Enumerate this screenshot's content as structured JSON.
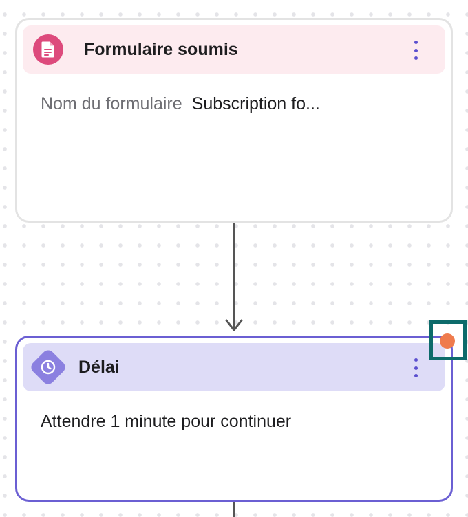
{
  "trigger_node": {
    "title": "Formulaire soumis",
    "icon": "form-document-icon",
    "field_label": "Nom du formulaire",
    "field_value": "Subscription fo..."
  },
  "delay_node": {
    "title": "Délai",
    "icon": "clock-icon",
    "description": "Attendre 1 minute pour continuer"
  },
  "colors": {
    "trigger_accent": "#dd4a7c",
    "trigger_header": "#fdebef",
    "delay_accent": "#8b80e0",
    "delay_header": "#dedcf7",
    "selected_border": "#6b5fd3",
    "status_dot": "#ef7b4d",
    "focus_outline": "#0d6b6b"
  }
}
